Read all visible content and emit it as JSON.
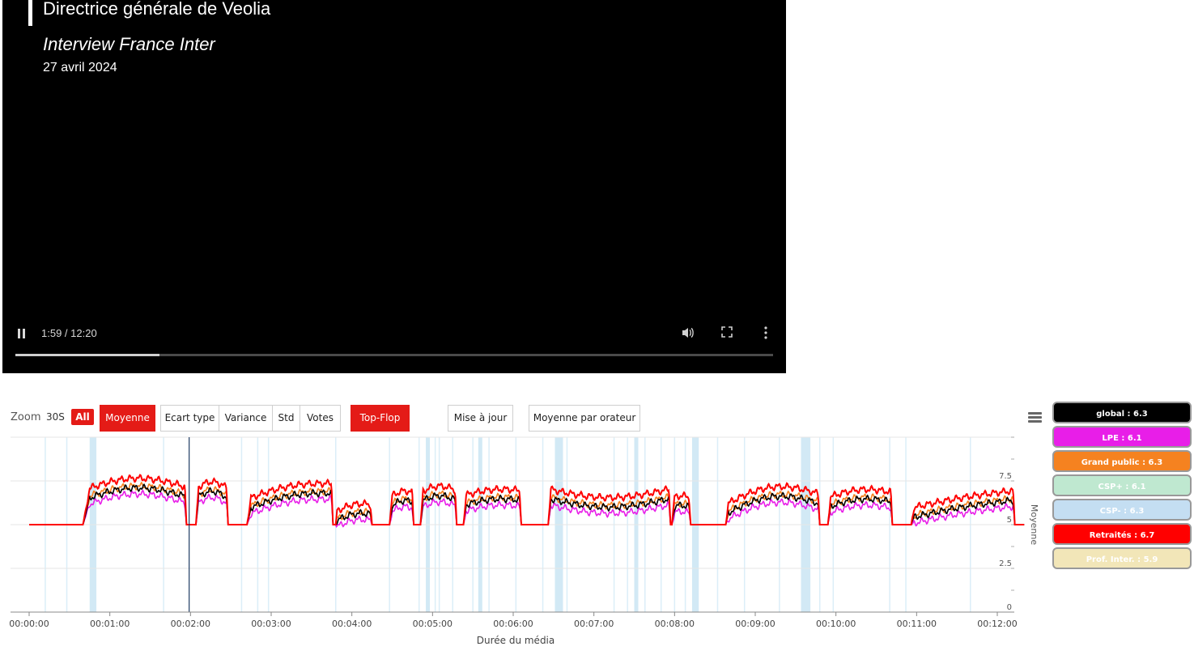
{
  "video": {
    "title": "Directrice générale de Veolia",
    "subtitle": "Interview France Inter",
    "date": "27 avril 2024",
    "time": "1:59 / 12:20",
    "progress": 0.19,
    "icons": [
      "pause-icon",
      "volume-icon",
      "fullscreen-icon",
      "more-options-icon"
    ]
  },
  "toolbar": {
    "zoom_label": "Zoom",
    "zoom_30s": "30S",
    "zoom_all": "All",
    "moyenne": "Moyenne",
    "ecart_type": "Ecart type",
    "variance": "Variance",
    "std": "Std",
    "votes": "Votes",
    "top_flop": "Top-Flop",
    "mise_a_jour": "Mise à jour",
    "moyenne_orateur": "Moyenne par orateur"
  },
  "legend": [
    {
      "label": "global : 6.3",
      "bg": "#000000",
      "fg": "#ffffff"
    },
    {
      "label": "LPE : 6.1",
      "bg": "#e81ee8",
      "fg": "#ffffff"
    },
    {
      "label": "Grand public : 6.3",
      "bg": "#f58220",
      "fg": "#ffffff"
    },
    {
      "label": "CSP+ : 6.1",
      "bg": "#bfe8d0",
      "fg": "#ffffff"
    },
    {
      "label": "CSP- : 6.3",
      "bg": "#c4def2",
      "fg": "#ffffff"
    },
    {
      "label": "Retraités : 6.7",
      "bg": "#ff0000",
      "fg": "#ffffff"
    },
    {
      "label": "Prof. Inter. : 5.9",
      "bg": "#f2e6b8",
      "fg": "#ffffff"
    }
  ],
  "chart_data": {
    "type": "line",
    "xlabel": "Durée du média",
    "ylabel": "Moyenne",
    "ylim": [
      0,
      10
    ],
    "yticks": [
      "0",
      "2.5",
      "5",
      "7.5"
    ],
    "xticks": [
      "00:00:00",
      "00:01:00",
      "00:02:00",
      "00:03:00",
      "00:04:00",
      "00:05:00",
      "00:06:00",
      "00:07:00",
      "00:08:00",
      "00:09:00",
      "00:10:00",
      "00:11:00",
      "00:12:00"
    ],
    "x_range_seconds": [
      0,
      740
    ],
    "cursor_seconds": 119,
    "bands_seconds": [
      [
        45,
        50
      ],
      [
        295,
        298
      ],
      [
        334,
        337
      ],
      [
        391,
        397
      ],
      [
        450,
        453
      ],
      [
        493,
        498
      ],
      [
        574,
        581
      ]
    ],
    "thin_lines_seconds": [
      12,
      28,
      100,
      158,
      170,
      178,
      228,
      268,
      290,
      302,
      305,
      315,
      330,
      342,
      362,
      382,
      392,
      400,
      435,
      445,
      458,
      470,
      480,
      488,
      512,
      532,
      558,
      588,
      598,
      640,
      652,
      700
    ],
    "segments": [
      {
        "start": 40,
        "end": 117,
        "rise": 5,
        "base": 6.4,
        "end_level": 6.6,
        "bump": 0.6
      },
      {
        "start": 124,
        "end": 148,
        "rise": 2,
        "base": 6.5,
        "end_level": 6.5,
        "bump": 0.4
      },
      {
        "start": 162,
        "end": 226,
        "rise": 3,
        "base": 5.9,
        "end_level": 6.8,
        "bump": 0.3
      },
      {
        "start": 228,
        "end": 255,
        "rise": 1,
        "base": 5.2,
        "end_level": 5.6,
        "bump": 0.2
      },
      {
        "start": 268,
        "end": 286,
        "rise": 2,
        "base": 6.0,
        "end_level": 6.3,
        "bump": 0.2
      },
      {
        "start": 291,
        "end": 318,
        "rise": 2,
        "base": 6.3,
        "end_level": 6.4,
        "bump": 0.3
      },
      {
        "start": 323,
        "end": 366,
        "rise": 2,
        "base": 6.1,
        "end_level": 6.4,
        "bump": 0.2
      },
      {
        "start": 386,
        "end": 477,
        "rise": 2,
        "base": 6.5,
        "end_level": 6.5,
        "bump": -0.5
      },
      {
        "start": 478,
        "end": 492,
        "rise": 2,
        "base": 6.0,
        "end_level": 6.0,
        "bump": 0.1
      },
      {
        "start": 518,
        "end": 588,
        "rise": 2,
        "base": 5.6,
        "end_level": 6.2,
        "bump": 0.7
      },
      {
        "start": 594,
        "end": 642,
        "rise": 2,
        "base": 6.0,
        "end_level": 6.3,
        "bump": 0.3
      },
      {
        "start": 656,
        "end": 733,
        "rise": 2,
        "base": 5.4,
        "end_level": 6.4,
        "bump": 0.1
      }
    ],
    "series": [
      {
        "name": "global",
        "color": "#000000",
        "offset": 0.0
      },
      {
        "name": "LPE",
        "color": "#e81ee8",
        "offset": -0.35
      },
      {
        "name": "Grand public",
        "color": "#f58220",
        "offset": 0.1
      },
      {
        "name": "Retraités",
        "color": "#ff0000",
        "offset": 0.55
      }
    ]
  }
}
